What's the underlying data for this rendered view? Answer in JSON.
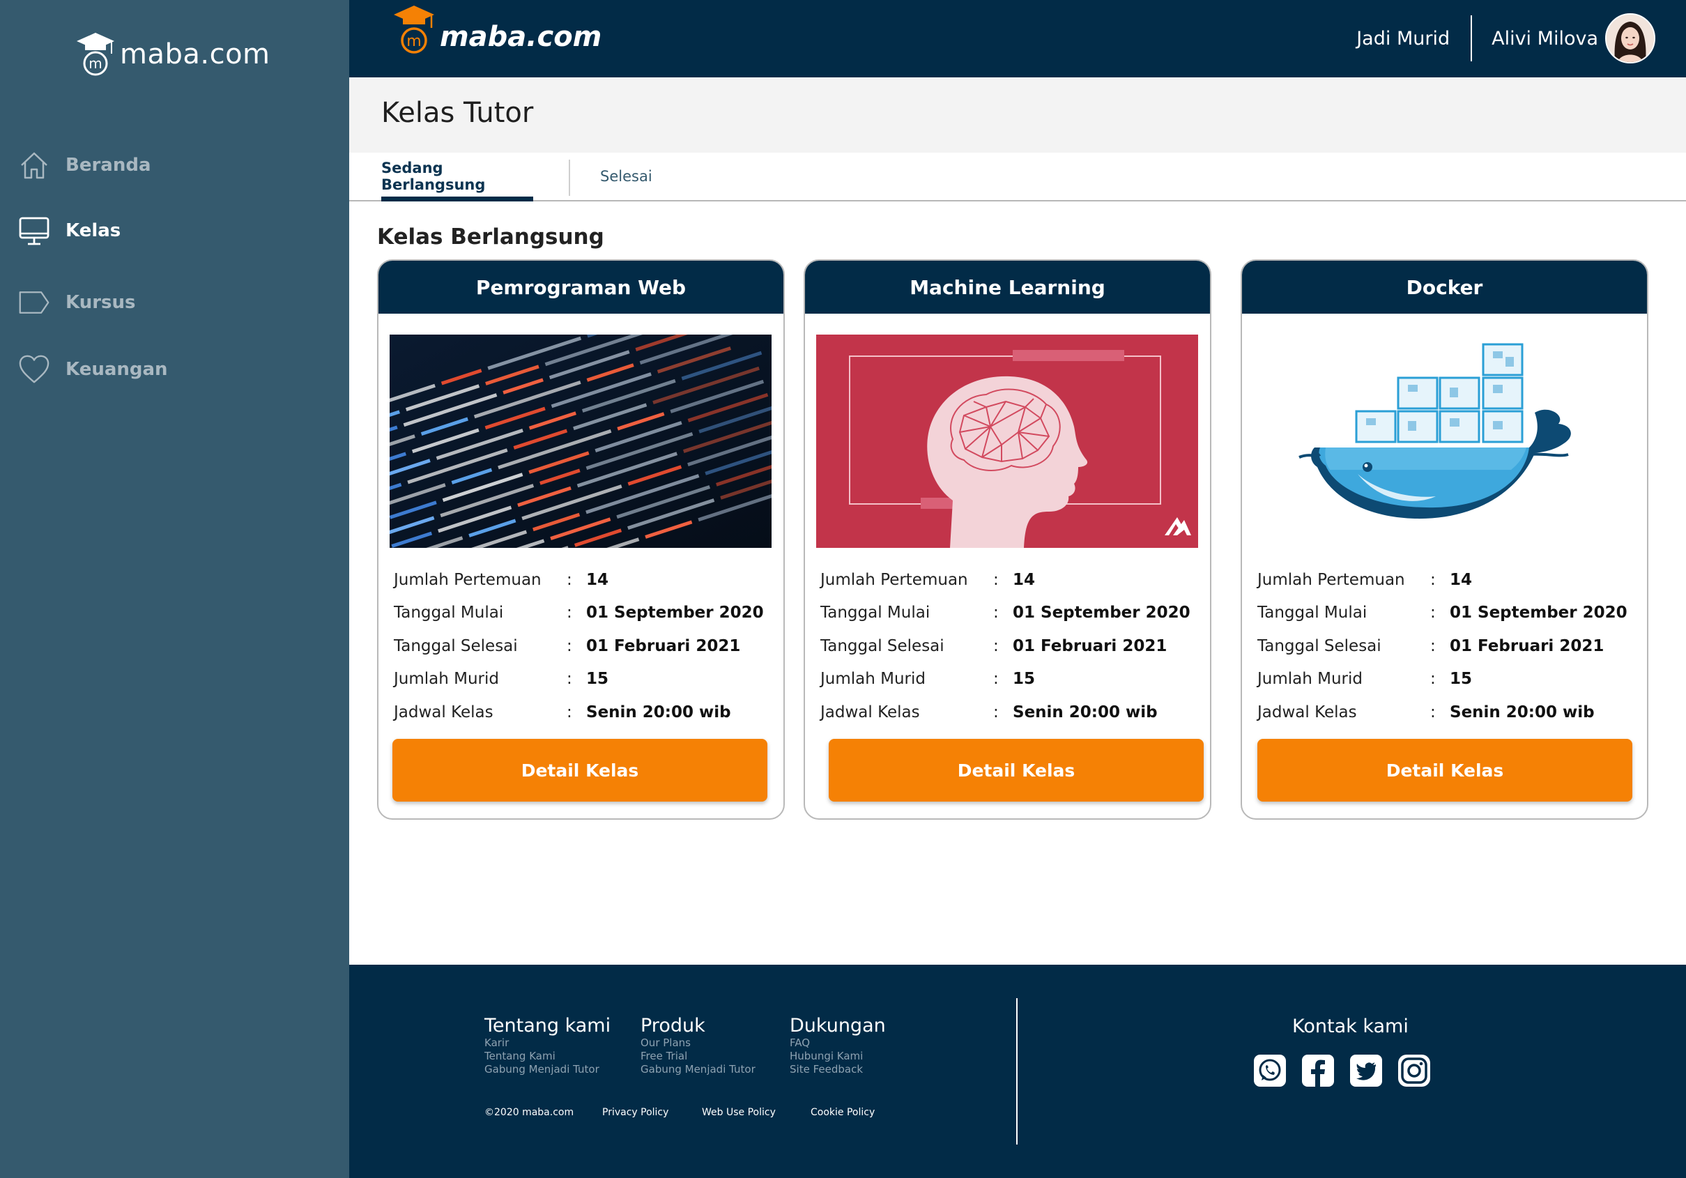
{
  "brand": {
    "logo_text": "maba.com",
    "logo_mark": "m"
  },
  "colors": {
    "sidebar": "#355a6e",
    "navy": "#022b47",
    "accent": "#f58105",
    "ml_image_bg": "#c2344a"
  },
  "sidebar": {
    "items": [
      {
        "label": "Beranda",
        "icon": "home-icon"
      },
      {
        "label": "Kelas",
        "icon": "monitor-icon",
        "active": true
      },
      {
        "label": "Kursus",
        "icon": "tag-icon"
      },
      {
        "label": "Keuangan",
        "icon": "heart-icon"
      }
    ]
  },
  "header": {
    "link": "Jadi Murid",
    "user_name": "Alivi Milova"
  },
  "page": {
    "title": "Kelas Tutor",
    "tabs": [
      {
        "label": "Sedang Berlangsung",
        "active": true
      },
      {
        "label": "Selesai",
        "active": false
      }
    ],
    "section_title": "Kelas Berlangsung"
  },
  "labels": {
    "jumlah_pertemuan": "Jumlah Pertemuan",
    "tanggal_mulai": "Tanggal Mulai",
    "tanggal_selesai": "Tanggal Selesai",
    "jumlah_murid": "Jumlah Murid",
    "jadwal_kelas": "Jadwal Kelas",
    "colon": ":"
  },
  "cards": [
    {
      "title": "Pemrograman Web",
      "pertemuan": "14",
      "mulai": "01 September 2020",
      "selesai": "01 Februari 2021",
      "murid": "15",
      "jadwal": "Senin 20:00 wib",
      "button": "Detail Kelas"
    },
    {
      "title": "Machine Learning",
      "pertemuan": "14",
      "mulai": "01 September 2020",
      "selesai": "01 Februari 2021",
      "murid": "15",
      "jadwal": "Senin 20:00 wib",
      "button": "Detail Kelas"
    },
    {
      "title": "Docker",
      "pertemuan": "14",
      "mulai": "01 September 2020",
      "selesai": "01 Februari 2021",
      "murid": "15",
      "jadwal": "Senin 20:00 wib",
      "button": "Detail Kelas"
    }
  ],
  "footer": {
    "columns": [
      {
        "title": "Tentang kami",
        "links": [
          "Karir",
          "Tentang Kami",
          "Gabung Menjadi Tutor"
        ]
      },
      {
        "title": "Produk",
        "links": [
          "Our Plans",
          "Free Trial",
          "Gabung Menjadi Tutor"
        ]
      },
      {
        "title": "Dukungan",
        "links": [
          "FAQ",
          "Hubungi Kami",
          "Site Feedback"
        ]
      }
    ],
    "bottom_links": [
      "©2020 maba.com",
      "Privacy Policy",
      "Web Use Policy",
      "Cookie Policy"
    ],
    "contact_title": "Kontak kami",
    "social": [
      "whatsapp-icon",
      "facebook-icon",
      "twitter-icon",
      "instagram-icon"
    ]
  }
}
